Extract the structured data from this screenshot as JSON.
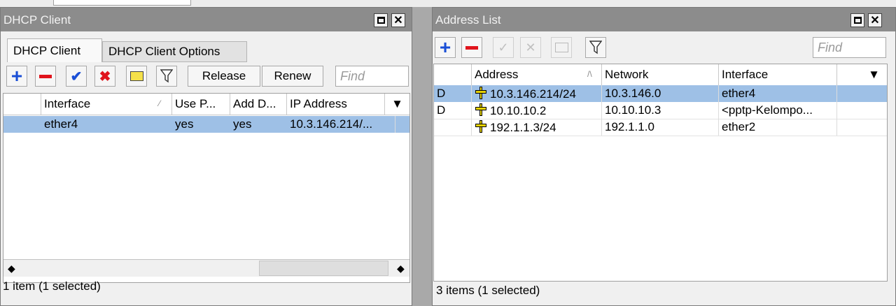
{
  "dhcp_window": {
    "title": "DHCP Client",
    "tabs": [
      {
        "label": "DHCP Client",
        "active": true
      },
      {
        "label": "DHCP Client Options",
        "active": false
      }
    ],
    "toolbar": {
      "release_label": "Release",
      "renew_label": "Renew",
      "find_placeholder": "Find"
    },
    "columns": [
      "Interface",
      "Use P...",
      "Add D...",
      "IP Address"
    ],
    "rows": [
      {
        "interface": "ether4",
        "use_peer": "yes",
        "add_default": "yes",
        "ip_address": "10.3.146.214/...",
        "selected": true
      }
    ],
    "status": "1 item (1 selected)"
  },
  "address_window": {
    "title": "Address List",
    "toolbar": {
      "find_placeholder": "Find"
    },
    "columns": [
      "Address",
      "Network",
      "Interface"
    ],
    "rows": [
      {
        "flag": "D",
        "address": "10.3.146.214/24",
        "network": "10.3.146.0",
        "interface": "ether4",
        "selected": true
      },
      {
        "flag": "D",
        "address": "10.10.10.2",
        "network": "10.10.10.3",
        "interface": "<pptp-Kelompo...",
        "selected": false
      },
      {
        "flag": "",
        "address": "192.1.1.3/24",
        "network": "192.1.1.0",
        "interface": "ether2",
        "selected": false
      }
    ],
    "status": "3 items (1 selected)"
  },
  "colors": {
    "titlebar": "#8c8c8c",
    "selected_row": "#9ec0e6",
    "add_icon": "#1a4fd6",
    "remove_icon": "#e0141c",
    "address_icon": "#d8c000"
  }
}
